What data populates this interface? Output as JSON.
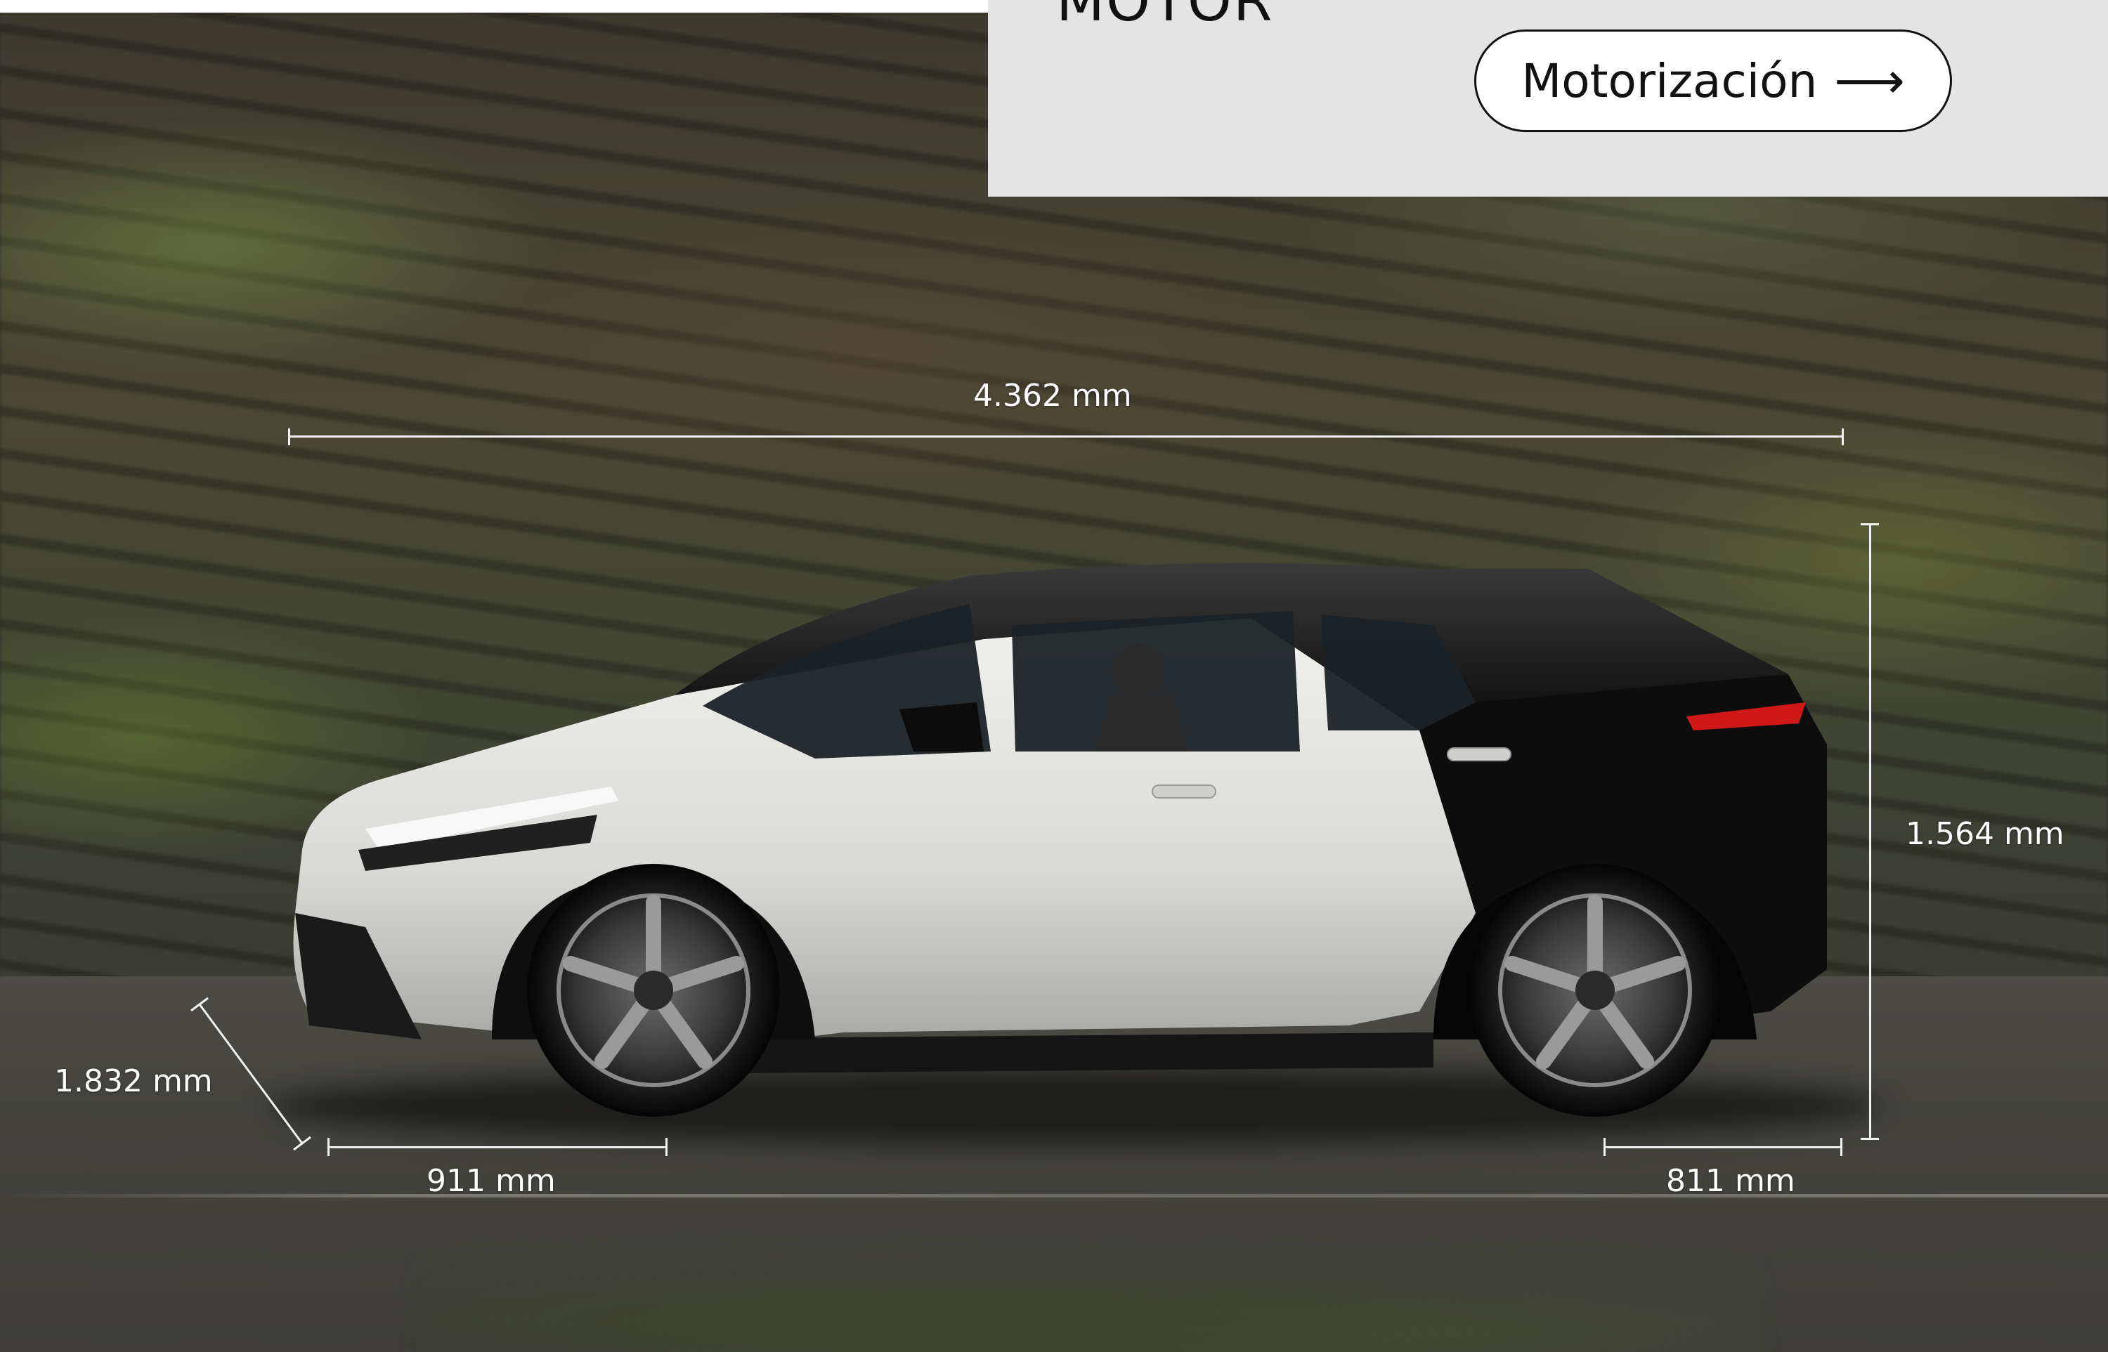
{
  "panel": {
    "title": "MOTOR",
    "button_label": "Motorización",
    "button_icon": "arrow-right-icon"
  },
  "dimensions": {
    "length": "4.362 mm",
    "height": "1.564 mm",
    "width": "1.832 mm",
    "front_overhang": "911 mm",
    "rear_overhang": "811 mm"
  },
  "colors": {
    "panel_bg": "#e4e4e4",
    "dimension_line": "#f2f2f2",
    "car_body": "#e6e6e3",
    "car_roof": "#111111",
    "tail_light": "#d01818"
  }
}
